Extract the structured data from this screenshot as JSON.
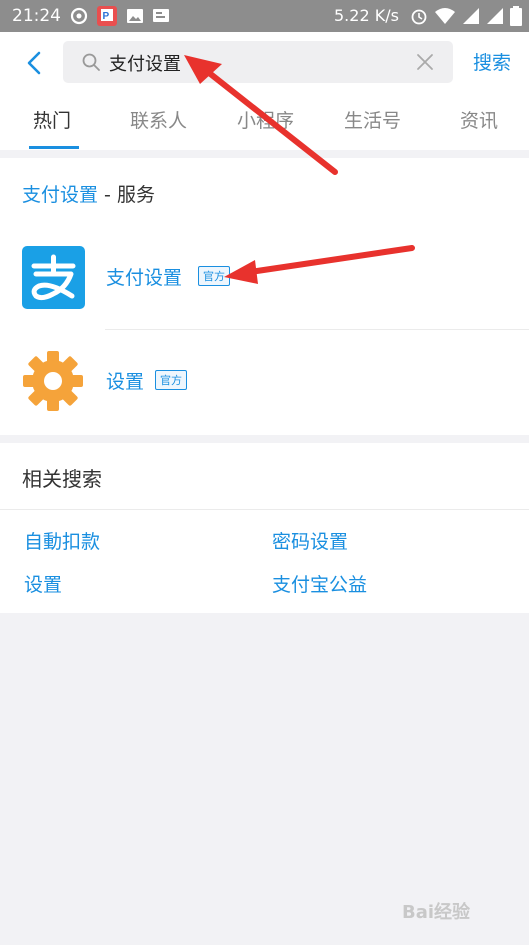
{
  "status_bar": {
    "time": "21:24",
    "network_speed": "5.22 K/s"
  },
  "search": {
    "query": "支付设置",
    "button_label": "搜索"
  },
  "tabs": [
    {
      "label": "热门"
    },
    {
      "label": "联系人"
    },
    {
      "label": "小程序"
    },
    {
      "label": "生活号"
    },
    {
      "label": "资讯"
    }
  ],
  "services": {
    "title_highlight": "支付设置",
    "title_suffix": " - 服务",
    "items": [
      {
        "name": "支付设置",
        "badge": "官方",
        "icon": "alipay-icon"
      },
      {
        "name": "设置",
        "badge": "官方",
        "icon": "gear-icon"
      }
    ]
  },
  "related": {
    "title": "相关搜索",
    "items": [
      "自動扣款",
      "密码设置",
      "设置",
      "支付宝公益"
    ]
  },
  "watermark": "Bai经验",
  "colors": {
    "accent": "#1a8fe0",
    "alipay_blue": "#1aa0e6",
    "gear_orange": "#f5a33a",
    "annotation_red": "#e8322d"
  }
}
